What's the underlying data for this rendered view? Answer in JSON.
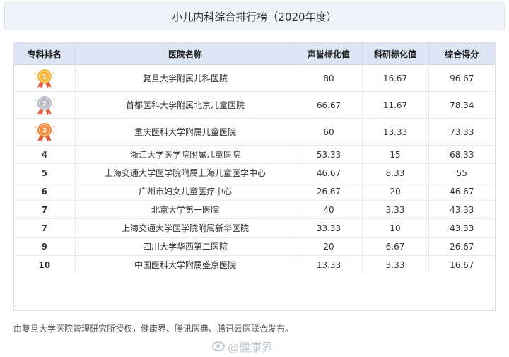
{
  "title": "小儿内科综合排行榜（2020年度）",
  "columns": [
    "专科排名",
    "医院名称",
    "声誉标化值",
    "科研标化值",
    "综合得分"
  ],
  "rows": [
    {
      "rank": "1",
      "name": "复旦大学附属儿科医院",
      "reputation": "80",
      "research": "16.67",
      "score": "96.67",
      "medal": "gold"
    },
    {
      "rank": "2",
      "name": "首都医科大学附属北京儿童医院",
      "reputation": "66.67",
      "research": "11.67",
      "score": "78.34",
      "medal": "silver"
    },
    {
      "rank": "3",
      "name": "重庆医科大学附属儿童医院",
      "reputation": "60",
      "research": "13.33",
      "score": "73.33",
      "medal": "bronze"
    },
    {
      "rank": "4",
      "name": "浙江大学医学院附属儿童医院",
      "reputation": "53.33",
      "research": "15",
      "score": "68.33"
    },
    {
      "rank": "5",
      "name": "上海交通大学医学院附属上海儿童医学中心",
      "reputation": "46.67",
      "research": "8.33",
      "score": "55"
    },
    {
      "rank": "6",
      "name": "广州市妇女儿童医疗中心",
      "reputation": "26.67",
      "research": "20",
      "score": "46.67"
    },
    {
      "rank": "7",
      "name": "北京大学第一医院",
      "reputation": "40",
      "research": "3.33",
      "score": "43.33"
    },
    {
      "rank": "7",
      "name": "上海交通大学医学院附属新华医院",
      "reputation": "33.33",
      "research": "10",
      "score": "43.33"
    },
    {
      "rank": "9",
      "name": "四川大学华西第二医院",
      "reputation": "20",
      "research": "6.67",
      "score": "26.67"
    },
    {
      "rank": "10",
      "name": "中国医科大学附属盛京医院",
      "reputation": "13.33",
      "research": "3.33",
      "score": "16.67"
    }
  ],
  "footer": "由复旦大学医院管理研究所授权，健康界、腾讯医典、腾讯云医联合发布。",
  "watermark": "@健康界",
  "colors": {
    "header_bg": "#f0f4fa",
    "table_header_bg": "#dde6f5",
    "gold": "#f3b53a",
    "silver": "#b9bcc2",
    "bronze": "#f08a3c",
    "ribbon": "#e45a3a"
  }
}
